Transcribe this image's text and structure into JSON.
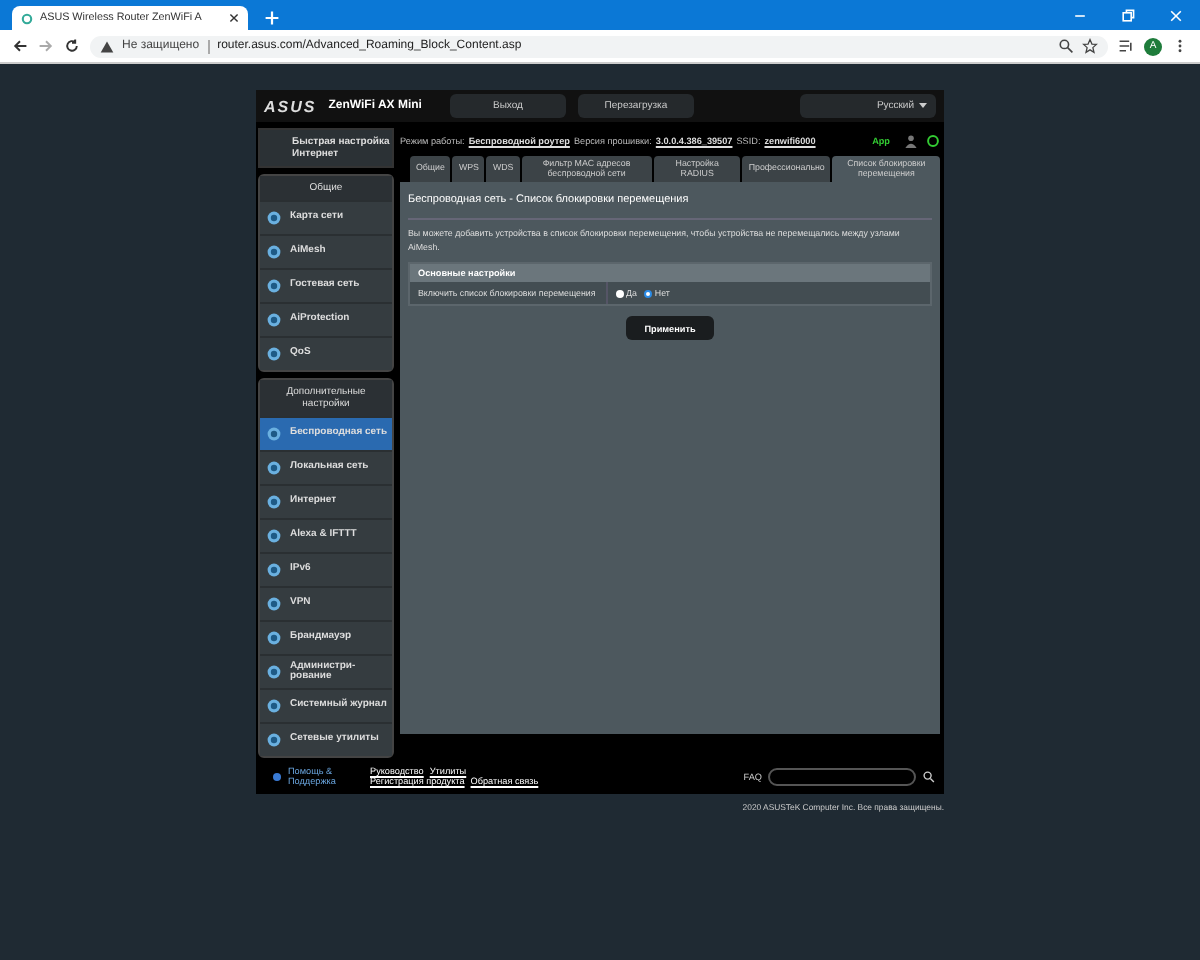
{
  "browser": {
    "tab_title": "ASUS Wireless Router ZenWiFi A",
    "security": "Не защищено",
    "url": "router.asus.com/Advanced_Roaming_Block_Content.asp",
    "avatar": "A"
  },
  "header": {
    "logo": "ASUS",
    "model": "ZenWiFi AX Mini",
    "buttons": [
      "Выход",
      "Перезагрузка"
    ],
    "language": "Русский"
  },
  "status": {
    "mode_label": "Режим работы:",
    "mode": "Беспроводной роутер",
    "fw_label": "Версия прошивки:",
    "fw": "3.0.0.4.386_39507",
    "ssid_label": "SSID:",
    "ssid": "zenwifi6000",
    "app": "App"
  },
  "quick_setup": "Быстрая настройка Интернет",
  "sidebar": [
    {
      "title": "Общие",
      "items": [
        {
          "label": "Карта сети",
          "selected": false
        },
        {
          "label": "AiMesh",
          "selected": false
        },
        {
          "label": "Гостевая сеть",
          "selected": false
        },
        {
          "label": "AiProtection",
          "selected": false
        },
        {
          "label": "QoS",
          "selected": false
        }
      ]
    },
    {
      "title": "Дополнительные настройки",
      "items": [
        {
          "label": "Беспроводная сеть",
          "selected": true
        },
        {
          "label": "Локальная сеть",
          "selected": false
        },
        {
          "label": "Интернет",
          "selected": false
        },
        {
          "label": "Alexa & IFTTT",
          "selected": false
        },
        {
          "label": "IPv6",
          "selected": false
        },
        {
          "label": "VPN",
          "selected": false
        },
        {
          "label": "Брандмауэр",
          "selected": false
        },
        {
          "label": "Администри-рование",
          "selected": false
        },
        {
          "label": "Системный журнал",
          "selected": false
        },
        {
          "label": "Сетевые утилиты",
          "selected": false
        }
      ]
    }
  ],
  "tabs": [
    {
      "label": "Общие",
      "selected": false
    },
    {
      "label": "WPS",
      "selected": false
    },
    {
      "label": "WDS",
      "selected": false
    },
    {
      "label": "Фильтр MAC адресов беспроводной сети",
      "selected": false
    },
    {
      "label": "Настройка RADIUS",
      "selected": false
    },
    {
      "label": "Профессионально",
      "selected": false
    },
    {
      "label": "Список блокировки перемещения",
      "selected": true
    }
  ],
  "content": {
    "title": "Беспроводная сеть - Список блокировки перемещения",
    "description": "Вы можете добавить устройства в список блокировки перемещения, чтобы устройства не перемещались между узлами AiMesh.",
    "section": "Основные настройки",
    "setting_label": "Включить список блокировки перемещения",
    "options": [
      {
        "label": "Да",
        "selected": false
      },
      {
        "label": "Нет",
        "selected": true
      }
    ],
    "apply": "Применить"
  },
  "footer": {
    "help": "Помощь & Поддержка",
    "links": [
      "Руководство",
      "Утилиты",
      "Регистрация продукта",
      "Обратная связь"
    ],
    "faq": "FAQ",
    "copyright": "2020 ASUSTeK Computer Inc. Все права защищены."
  }
}
